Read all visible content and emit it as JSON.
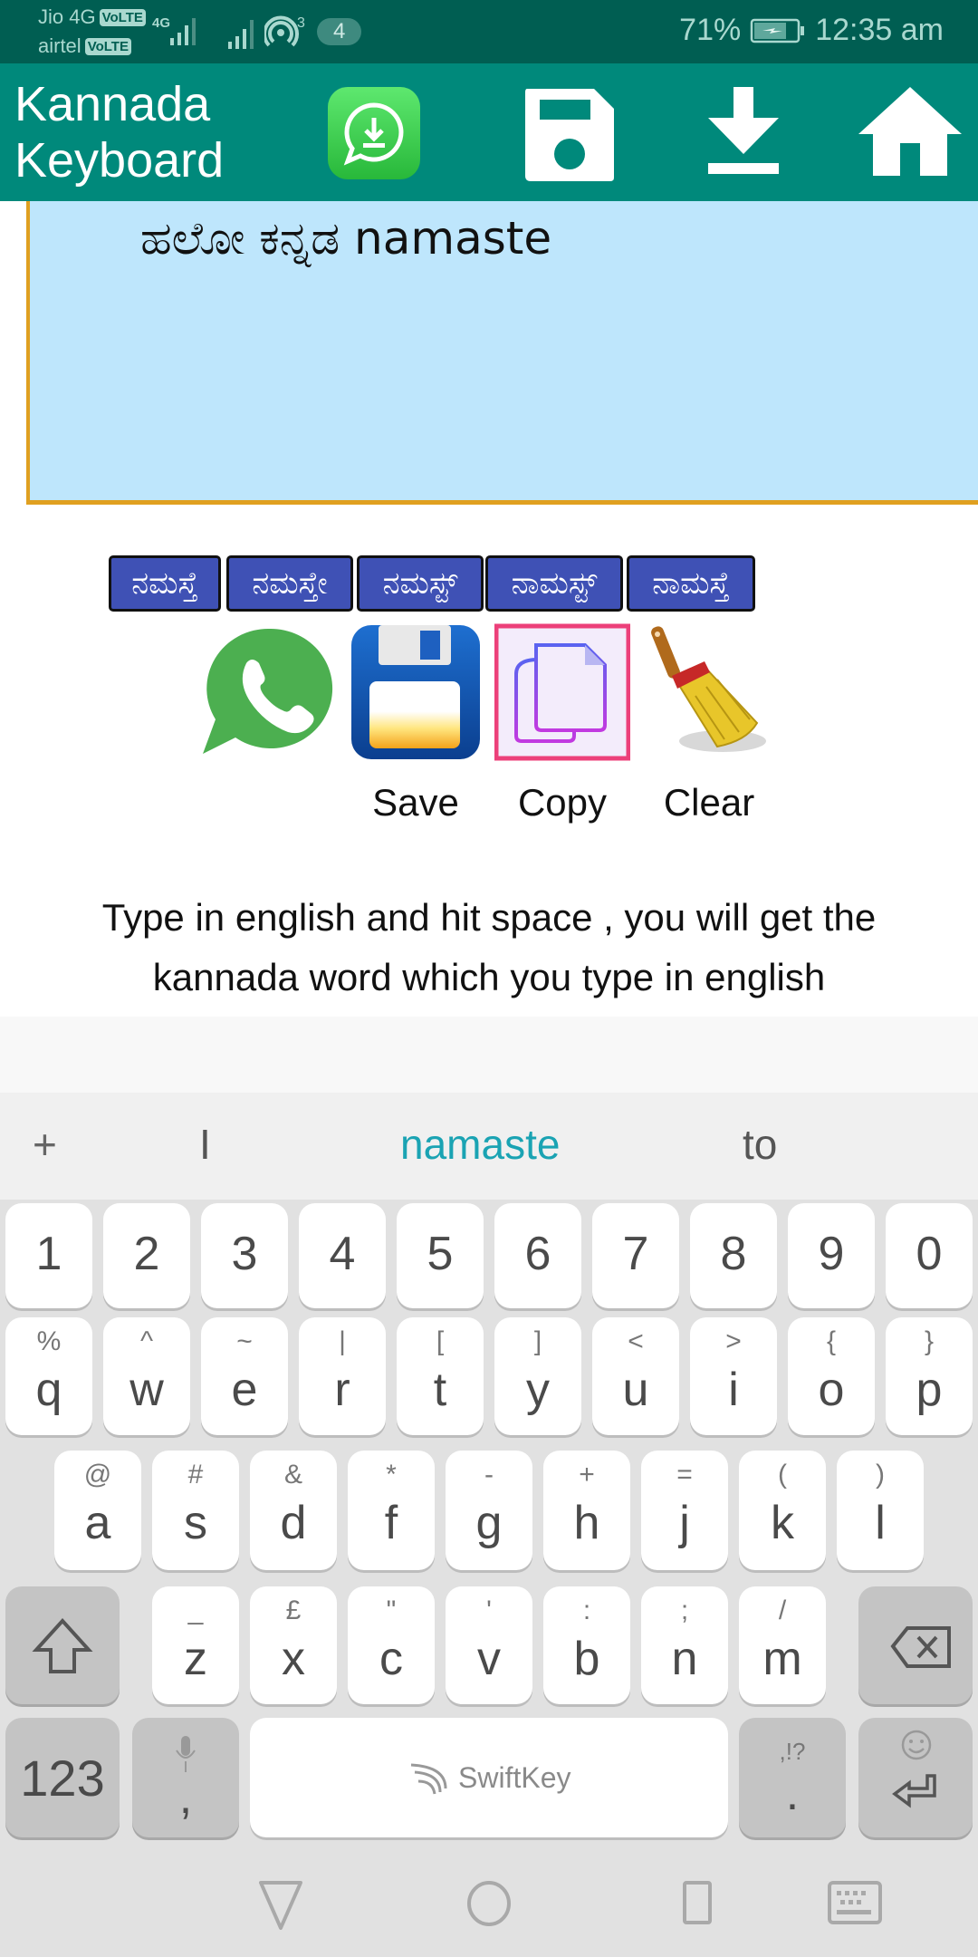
{
  "status_bar": {
    "carrier1": "Jio 4G",
    "carrier2": "airtel",
    "volte": "VoLTE",
    "network_type": "4G",
    "hotspot_count": "3",
    "notification_count": "4",
    "battery": "71%",
    "time": "12:35 am"
  },
  "app_bar": {
    "title": "Kannada Keyboard",
    "icons": [
      "whatsapp-status-download-icon",
      "save-icon",
      "download-icon",
      "home-icon"
    ]
  },
  "editor": {
    "text": "ಹಲೋ ಕನ್ನಡ namaste"
  },
  "suggestions_chips": [
    "ನಮಸ್ತೆ",
    "ನಮಸ್ತೇ",
    "ನಮಸ್ಟ್",
    "ನಾಮಸ್ಟ್",
    "ನಾಮಸ್ತೆ"
  ],
  "actions": {
    "whatsapp_label": "",
    "save_label": "Save",
    "copy_label": "Copy",
    "clear_label": "Clear"
  },
  "help_text": "Type in english and hit space , you will get the kannada word which you type in english",
  "keyboard": {
    "suggestions": {
      "plus": "+",
      "left": "I",
      "center": "namaste",
      "right": "to"
    },
    "accent_color": "#1aa3b3",
    "number_row": [
      "1",
      "2",
      "3",
      "4",
      "5",
      "6",
      "7",
      "8",
      "9",
      "0"
    ],
    "row1": [
      {
        "main": "q",
        "sub": "%"
      },
      {
        "main": "w",
        "sub": "^"
      },
      {
        "main": "e",
        "sub": "~"
      },
      {
        "main": "r",
        "sub": "|"
      },
      {
        "main": "t",
        "sub": "["
      },
      {
        "main": "y",
        "sub": "]"
      },
      {
        "main": "u",
        "sub": "<"
      },
      {
        "main": "i",
        "sub": ">"
      },
      {
        "main": "o",
        "sub": "{"
      },
      {
        "main": "p",
        "sub": "}"
      }
    ],
    "row2": [
      {
        "main": "a",
        "sub": "@"
      },
      {
        "main": "s",
        "sub": "#"
      },
      {
        "main": "d",
        "sub": "&"
      },
      {
        "main": "f",
        "sub": "*"
      },
      {
        "main": "g",
        "sub": "-"
      },
      {
        "main": "h",
        "sub": "+"
      },
      {
        "main": "j",
        "sub": "="
      },
      {
        "main": "k",
        "sub": "("
      },
      {
        "main": "l",
        "sub": ")"
      }
    ],
    "row3": [
      {
        "main": "z",
        "sub": "_"
      },
      {
        "main": "x",
        "sub": "£"
      },
      {
        "main": "c",
        "sub": "\""
      },
      {
        "main": "v",
        "sub": "'"
      },
      {
        "main": "b",
        "sub": ":"
      },
      {
        "main": "n",
        "sub": ";"
      },
      {
        "main": "m",
        "sub": "/"
      }
    ],
    "symbols_key": "123",
    "comma_key": ",",
    "space_brand": "SwiftKey",
    "period_key": ".",
    "period_sub": ",!?"
  },
  "nav_bar": {
    "icons": [
      "back-icon",
      "home-icon",
      "recents-icon",
      "keyboard-icon"
    ]
  }
}
